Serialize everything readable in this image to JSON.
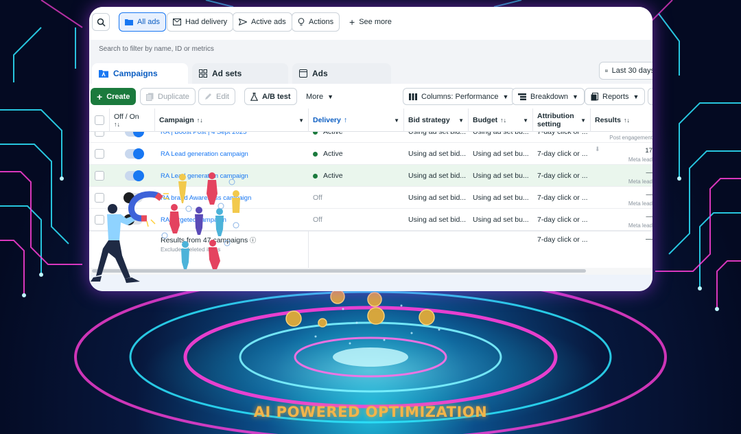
{
  "filters": {
    "all_ads": "All ads",
    "had_delivery": "Had delivery",
    "active_ads": "Active ads",
    "actions": "Actions",
    "see_more": "See more",
    "search_placeholder": "Search to filter by name, ID or metrics"
  },
  "tabs": [
    {
      "label": "Campaigns"
    },
    {
      "label": "Ad sets"
    },
    {
      "label": "Ads"
    }
  ],
  "date_range": "Last 30 days",
  "toolbar": {
    "create": "Create",
    "duplicate": "Duplicate",
    "edit": "Edit",
    "ab_test": "A/B test",
    "more": "More",
    "columns": "Columns: Performance",
    "breakdown": "Breakdown",
    "reports": "Reports"
  },
  "columns": {
    "off_on": "Off / On",
    "campaign": "Campaign",
    "delivery": "Delivery",
    "bid_strategy": "Bid strategy",
    "budget": "Budget",
    "attribution_1": "Attribution",
    "attribution_2": "setting",
    "results": "Results"
  },
  "rows": [
    {
      "campaign": "RA | Boost Post | 4 Sept 2025",
      "delivery": "Active",
      "bid": "Using ad set bid...",
      "budget": "Using ad set bu...",
      "attribution": "7-day click or ...",
      "result": "",
      "result_type": "Post engagement",
      "on": true,
      "active": true
    },
    {
      "campaign": "RA Lead generation campaign",
      "delivery": "Active",
      "bid": "Using ad set bid...",
      "budget": "Using ad set bu...",
      "attribution": "7-day click or ...",
      "result": "17",
      "result_type": "Meta lead",
      "on": true,
      "active": true
    },
    {
      "campaign": "RA Lead generation campaign",
      "delivery": "Active",
      "bid": "Using ad set bid...",
      "budget": "Using ad set bu...",
      "attribution": "7-day click or ...",
      "result": "—",
      "result_type": "Meta lead",
      "on": true,
      "active": true
    },
    {
      "campaign": "RA brand Awareness campaign",
      "delivery": "Off",
      "bid": "Using ad set bid...",
      "budget": "Using ad set bu...",
      "attribution": "7-day click or ...",
      "result": "—",
      "result_type": "Meta lead",
      "on": false,
      "active": false
    },
    {
      "campaign": "RA Targeted campaign",
      "delivery": "Off",
      "bid": "Using ad set bid...",
      "budget": "Using ad set bu...",
      "attribution": "7-day click or ...",
      "result": "—",
      "result_type": "Meta lead",
      "on": false,
      "active": false
    }
  ],
  "summary": {
    "title": "Results from 47 campaigns",
    "note": "Excludes deleted items",
    "attribution": "7-day click or ...",
    "result": "—"
  },
  "headline": "AI POWERED OPTIMIZATION",
  "colors": {
    "primary": "#1877f2",
    "create_green": "#1b7a3d",
    "headline_gold": "#f3b54a",
    "neon_pink": "#ff3fd8",
    "neon_cyan": "#2ee6ff"
  }
}
